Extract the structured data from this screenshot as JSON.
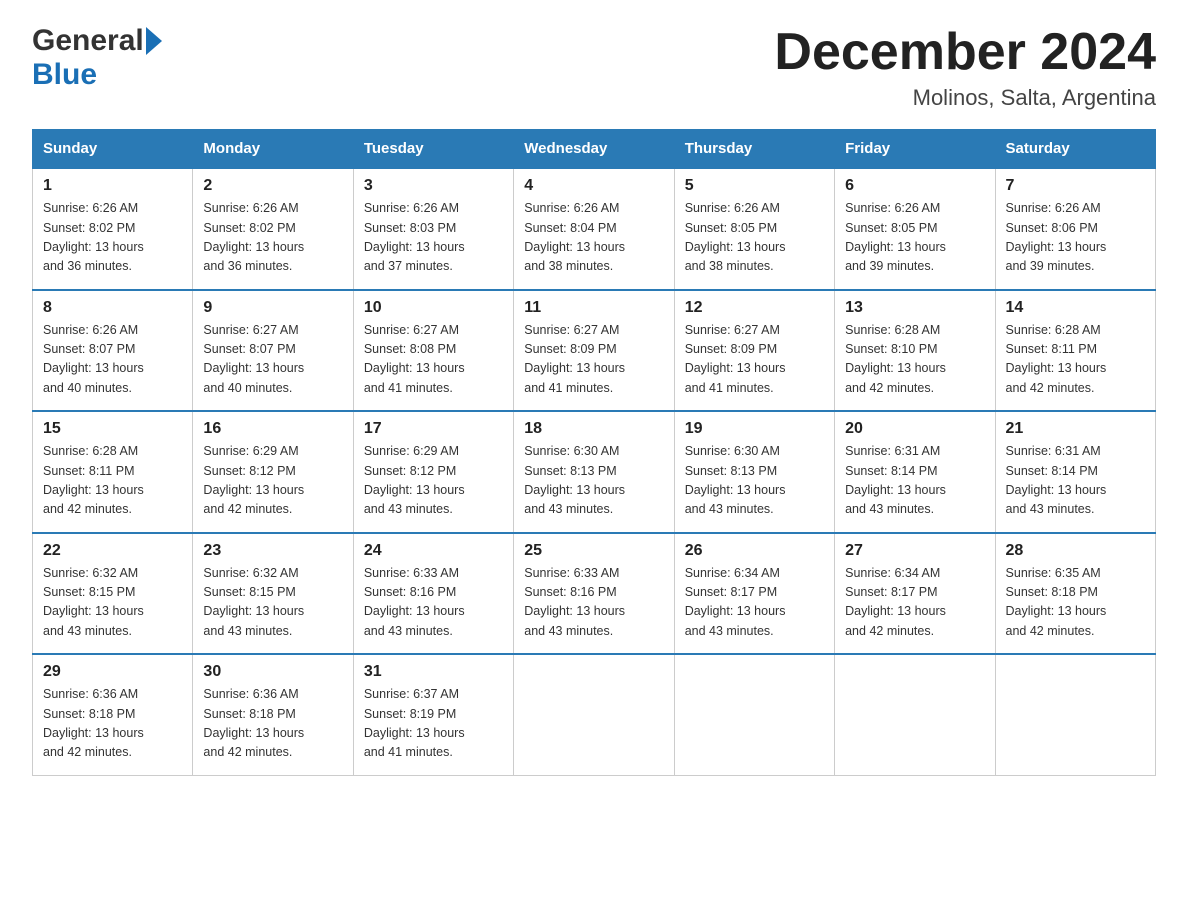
{
  "header": {
    "logo_general": "General",
    "logo_blue": "Blue",
    "title": "December 2024",
    "subtitle": "Molinos, Salta, Argentina"
  },
  "weekdays": [
    "Sunday",
    "Monday",
    "Tuesday",
    "Wednesday",
    "Thursday",
    "Friday",
    "Saturday"
  ],
  "weeks": [
    [
      {
        "day": "1",
        "sunrise": "6:26 AM",
        "sunset": "8:02 PM",
        "daylight": "13 hours and 36 minutes."
      },
      {
        "day": "2",
        "sunrise": "6:26 AM",
        "sunset": "8:02 PM",
        "daylight": "13 hours and 36 minutes."
      },
      {
        "day": "3",
        "sunrise": "6:26 AM",
        "sunset": "8:03 PM",
        "daylight": "13 hours and 37 minutes."
      },
      {
        "day": "4",
        "sunrise": "6:26 AM",
        "sunset": "8:04 PM",
        "daylight": "13 hours and 38 minutes."
      },
      {
        "day": "5",
        "sunrise": "6:26 AM",
        "sunset": "8:05 PM",
        "daylight": "13 hours and 38 minutes."
      },
      {
        "day": "6",
        "sunrise": "6:26 AM",
        "sunset": "8:05 PM",
        "daylight": "13 hours and 39 minutes."
      },
      {
        "day": "7",
        "sunrise": "6:26 AM",
        "sunset": "8:06 PM",
        "daylight": "13 hours and 39 minutes."
      }
    ],
    [
      {
        "day": "8",
        "sunrise": "6:26 AM",
        "sunset": "8:07 PM",
        "daylight": "13 hours and 40 minutes."
      },
      {
        "day": "9",
        "sunrise": "6:27 AM",
        "sunset": "8:07 PM",
        "daylight": "13 hours and 40 minutes."
      },
      {
        "day": "10",
        "sunrise": "6:27 AM",
        "sunset": "8:08 PM",
        "daylight": "13 hours and 41 minutes."
      },
      {
        "day": "11",
        "sunrise": "6:27 AM",
        "sunset": "8:09 PM",
        "daylight": "13 hours and 41 minutes."
      },
      {
        "day": "12",
        "sunrise": "6:27 AM",
        "sunset": "8:09 PM",
        "daylight": "13 hours and 41 minutes."
      },
      {
        "day": "13",
        "sunrise": "6:28 AM",
        "sunset": "8:10 PM",
        "daylight": "13 hours and 42 minutes."
      },
      {
        "day": "14",
        "sunrise": "6:28 AM",
        "sunset": "8:11 PM",
        "daylight": "13 hours and 42 minutes."
      }
    ],
    [
      {
        "day": "15",
        "sunrise": "6:28 AM",
        "sunset": "8:11 PM",
        "daylight": "13 hours and 42 minutes."
      },
      {
        "day": "16",
        "sunrise": "6:29 AM",
        "sunset": "8:12 PM",
        "daylight": "13 hours and 42 minutes."
      },
      {
        "day": "17",
        "sunrise": "6:29 AM",
        "sunset": "8:12 PM",
        "daylight": "13 hours and 43 minutes."
      },
      {
        "day": "18",
        "sunrise": "6:30 AM",
        "sunset": "8:13 PM",
        "daylight": "13 hours and 43 minutes."
      },
      {
        "day": "19",
        "sunrise": "6:30 AM",
        "sunset": "8:13 PM",
        "daylight": "13 hours and 43 minutes."
      },
      {
        "day": "20",
        "sunrise": "6:31 AM",
        "sunset": "8:14 PM",
        "daylight": "13 hours and 43 minutes."
      },
      {
        "day": "21",
        "sunrise": "6:31 AM",
        "sunset": "8:14 PM",
        "daylight": "13 hours and 43 minutes."
      }
    ],
    [
      {
        "day": "22",
        "sunrise": "6:32 AM",
        "sunset": "8:15 PM",
        "daylight": "13 hours and 43 minutes."
      },
      {
        "day": "23",
        "sunrise": "6:32 AM",
        "sunset": "8:15 PM",
        "daylight": "13 hours and 43 minutes."
      },
      {
        "day": "24",
        "sunrise": "6:33 AM",
        "sunset": "8:16 PM",
        "daylight": "13 hours and 43 minutes."
      },
      {
        "day": "25",
        "sunrise": "6:33 AM",
        "sunset": "8:16 PM",
        "daylight": "13 hours and 43 minutes."
      },
      {
        "day": "26",
        "sunrise": "6:34 AM",
        "sunset": "8:17 PM",
        "daylight": "13 hours and 43 minutes."
      },
      {
        "day": "27",
        "sunrise": "6:34 AM",
        "sunset": "8:17 PM",
        "daylight": "13 hours and 42 minutes."
      },
      {
        "day": "28",
        "sunrise": "6:35 AM",
        "sunset": "8:18 PM",
        "daylight": "13 hours and 42 minutes."
      }
    ],
    [
      {
        "day": "29",
        "sunrise": "6:36 AM",
        "sunset": "8:18 PM",
        "daylight": "13 hours and 42 minutes."
      },
      {
        "day": "30",
        "sunrise": "6:36 AM",
        "sunset": "8:18 PM",
        "daylight": "13 hours and 42 minutes."
      },
      {
        "day": "31",
        "sunrise": "6:37 AM",
        "sunset": "8:19 PM",
        "daylight": "13 hours and 41 minutes."
      },
      null,
      null,
      null,
      null
    ]
  ],
  "labels": {
    "sunrise": "Sunrise:",
    "sunset": "Sunset:",
    "daylight": "Daylight:"
  },
  "accent_color": "#2a7ab5"
}
